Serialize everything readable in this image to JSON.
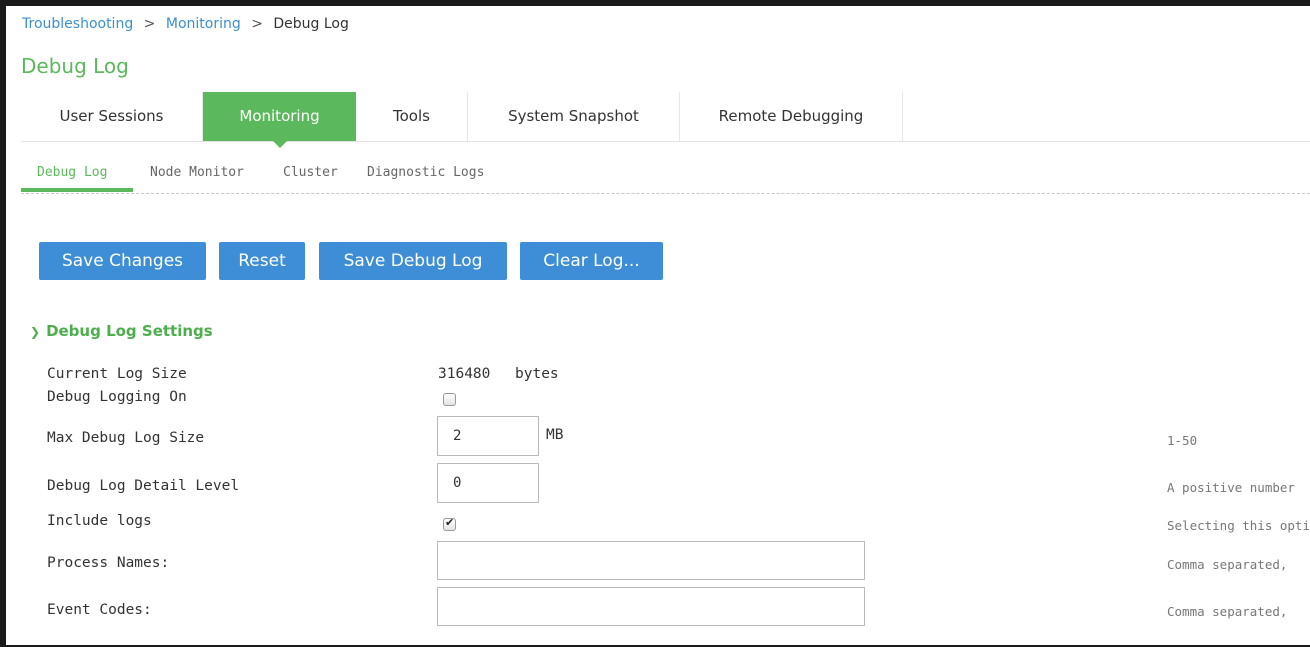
{
  "breadcrumb": {
    "link1": "Troubleshooting",
    "sep1": ">",
    "link2": "Monitoring",
    "sep2": ">",
    "current": "Debug Log"
  },
  "page_title": "Debug Log",
  "tabs": [
    {
      "label": "User Sessions"
    },
    {
      "label": "Monitoring",
      "active": true
    },
    {
      "label": "Tools"
    },
    {
      "label": "System Snapshot"
    },
    {
      "label": "Remote Debugging"
    }
  ],
  "subtabs": [
    {
      "label": "Debug Log",
      "active": true
    },
    {
      "label": "Node Monitor"
    },
    {
      "label": "Cluster"
    },
    {
      "label": "Diagnostic Logs"
    }
  ],
  "buttons": {
    "save_changes": "Save Changes",
    "reset": "Reset",
    "save_debug_log": "Save Debug Log",
    "clear_log": "Clear Log..."
  },
  "section": {
    "title": "Debug Log Settings",
    "chevron_icon": "chevron-down-icon"
  },
  "settings": {
    "current_log_size": {
      "label": "Current Log Size",
      "value": "316480",
      "unit": "bytes"
    },
    "debug_logging_on": {
      "label": "Debug Logging On",
      "checked": false
    },
    "max_debug_log_size": {
      "label": "Max Debug Log Size",
      "value": "2",
      "unit": "MB",
      "help": "1-50"
    },
    "debug_log_detail_level": {
      "label": "Debug Log Detail Level",
      "value": "0",
      "help": "A positive number"
    },
    "include_logs": {
      "label": "Include logs",
      "checked": true,
      "help": "Selecting this optio"
    },
    "process_names": {
      "label": "Process Names:",
      "value": "",
      "help": "Comma separated,"
    },
    "event_codes": {
      "label": "Event Codes:",
      "value": "",
      "help": "Comma separated,"
    }
  },
  "colors": {
    "accent_green": "#5cb85c",
    "button_blue": "#3d8ed6",
    "link_blue": "#3b8fd1"
  }
}
